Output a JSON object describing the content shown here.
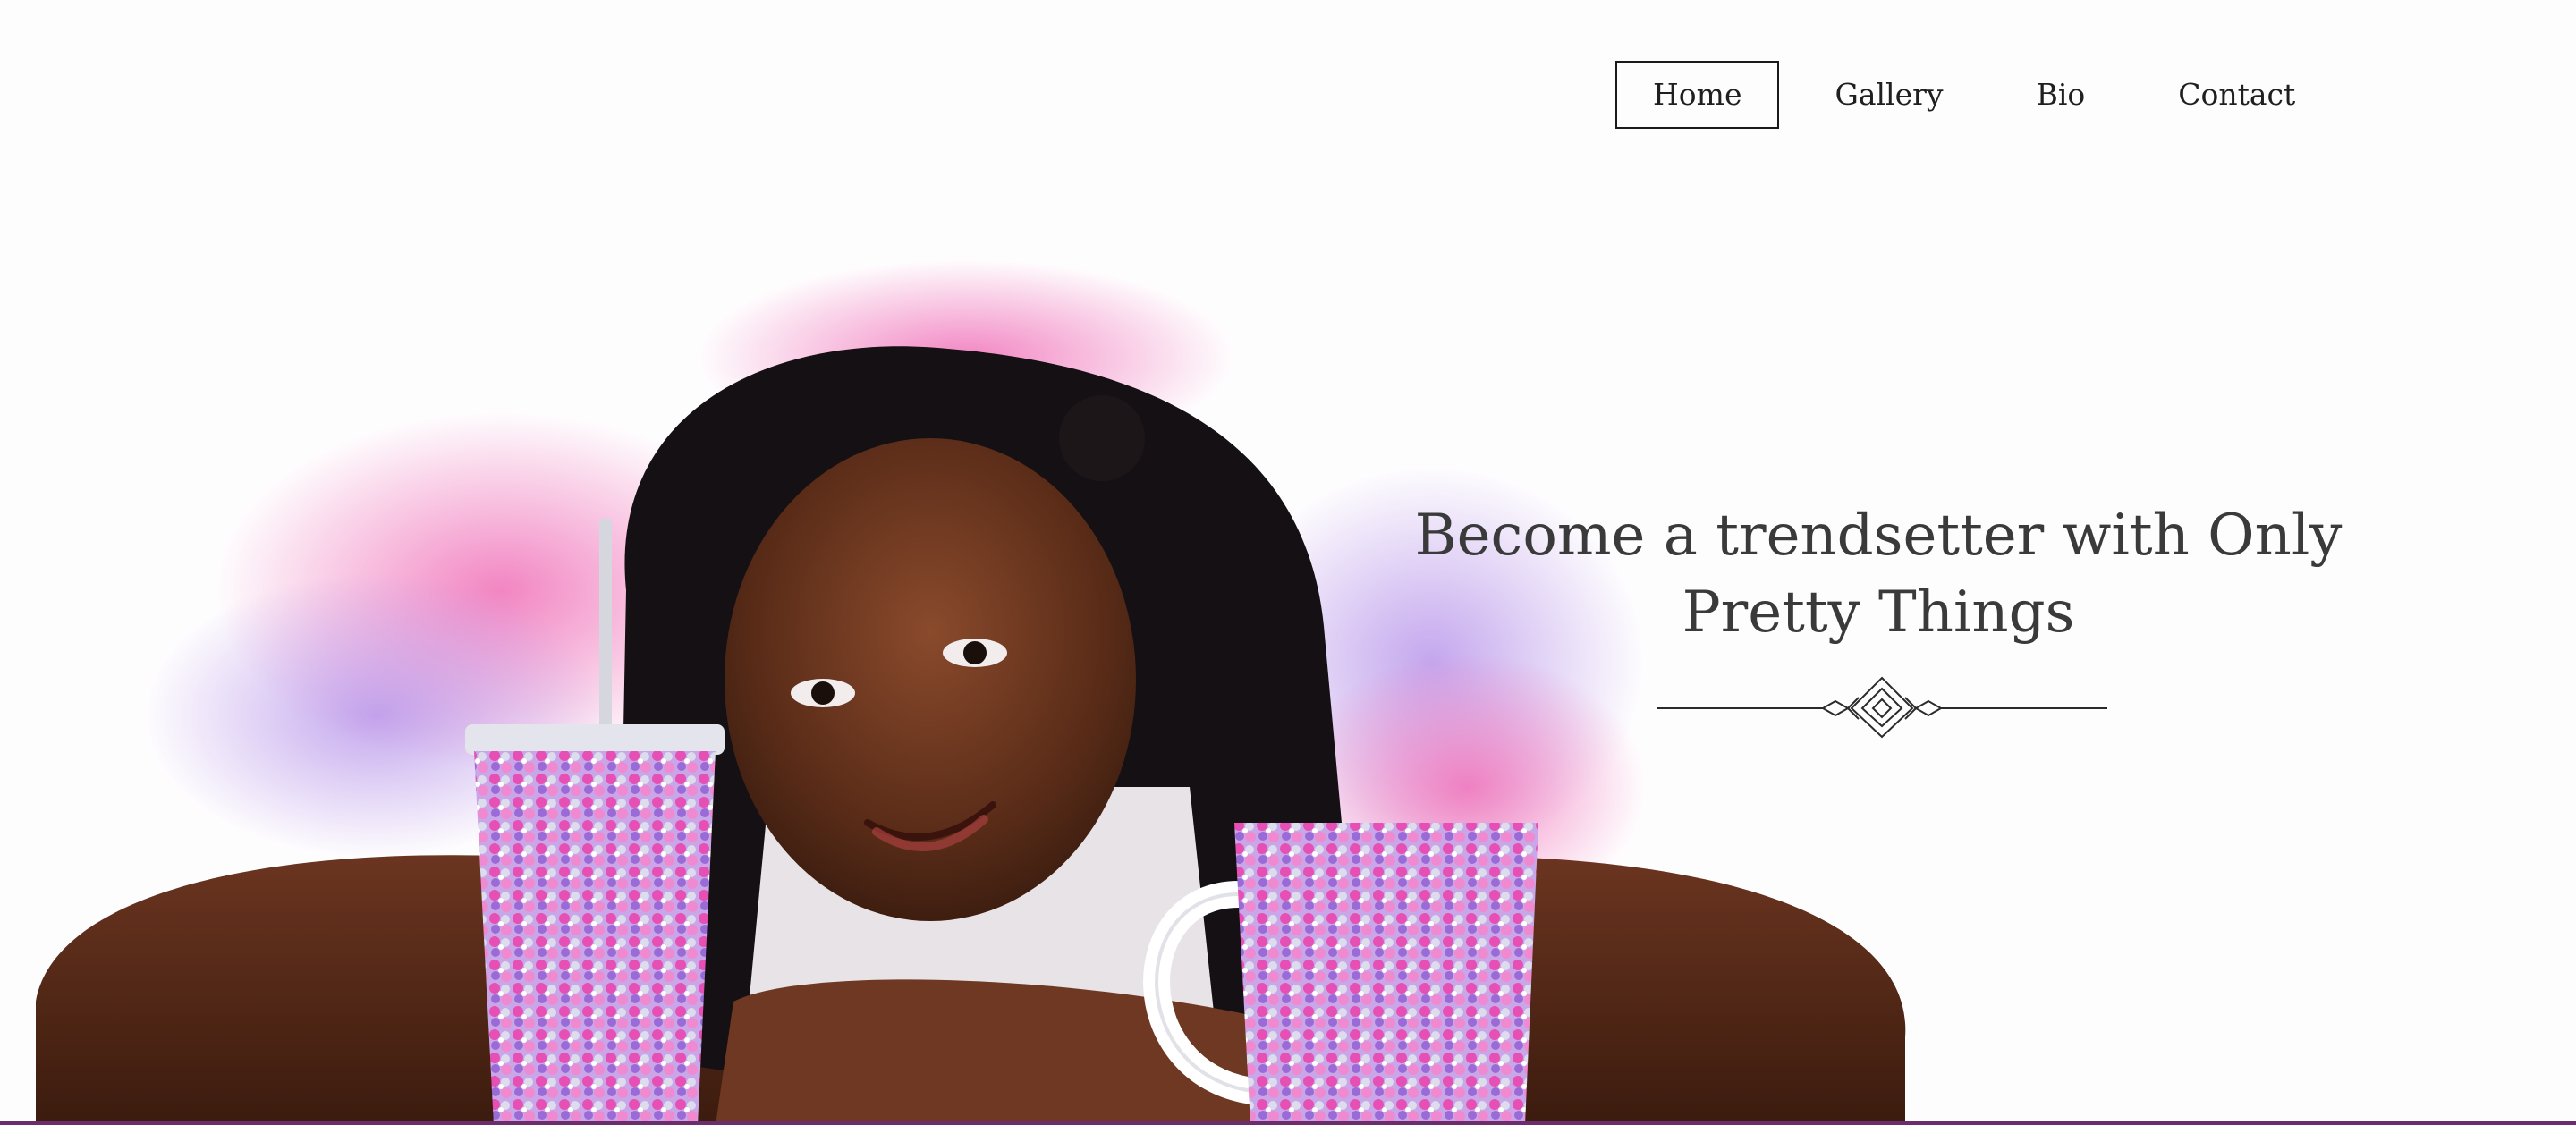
{
  "nav": {
    "items": [
      {
        "label": "Home",
        "active": true
      },
      {
        "label": "Gallery",
        "active": false
      },
      {
        "label": "Bio",
        "active": false
      },
      {
        "label": "Contact",
        "active": false
      }
    ]
  },
  "hero": {
    "headline": "Become a trendsetter with Only Pretty Things",
    "ornament_icon": "decorative-divider-icon"
  },
  "colors": {
    "accent": "#6b2d6b",
    "pink": "#e64fb4",
    "lavender": "#b58ee0",
    "text": "#3a3a3a"
  }
}
